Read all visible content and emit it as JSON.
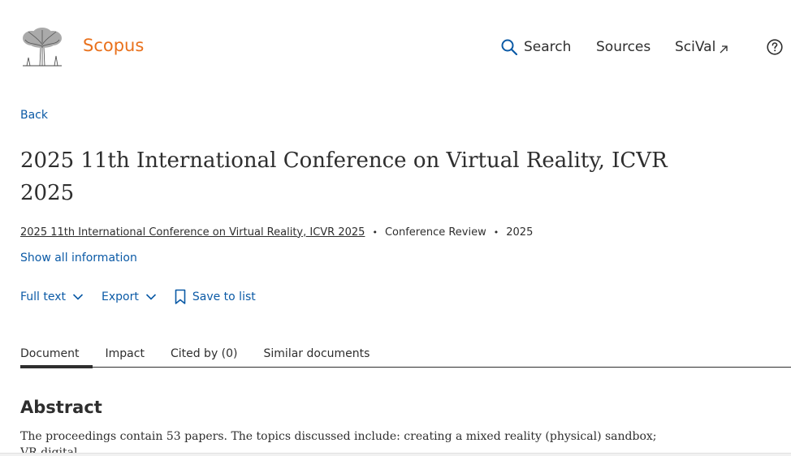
{
  "header": {
    "brand": "Scopus",
    "nav": {
      "search_label": "Search",
      "sources_label": "Sources",
      "scival_label": "SciVal"
    }
  },
  "back_label": "Back",
  "document": {
    "title": "2025 11th International Conference on Virtual Reality, ICVR 2025",
    "source": "2025 11th International Conference on Virtual Reality, ICVR 2025",
    "doc_type": "Conference Review",
    "year": "2025",
    "show_all_label": "Show all information"
  },
  "actions": {
    "full_text_label": "Full text",
    "export_label": "Export",
    "save_label": "Save to list"
  },
  "tabs": [
    {
      "label": "Document"
    },
    {
      "label": "Impact"
    },
    {
      "label": "Cited by (0)"
    },
    {
      "label": "Similar documents"
    }
  ],
  "abstract": {
    "heading": "Abstract",
    "text": "The proceedings contain 53 papers. The topics discussed include: creating a mixed reality (physical) sandbox; VR digital"
  },
  "colors": {
    "brand": "#e9711c",
    "link": "#0b5aa6",
    "text": "#2e2e2e"
  }
}
